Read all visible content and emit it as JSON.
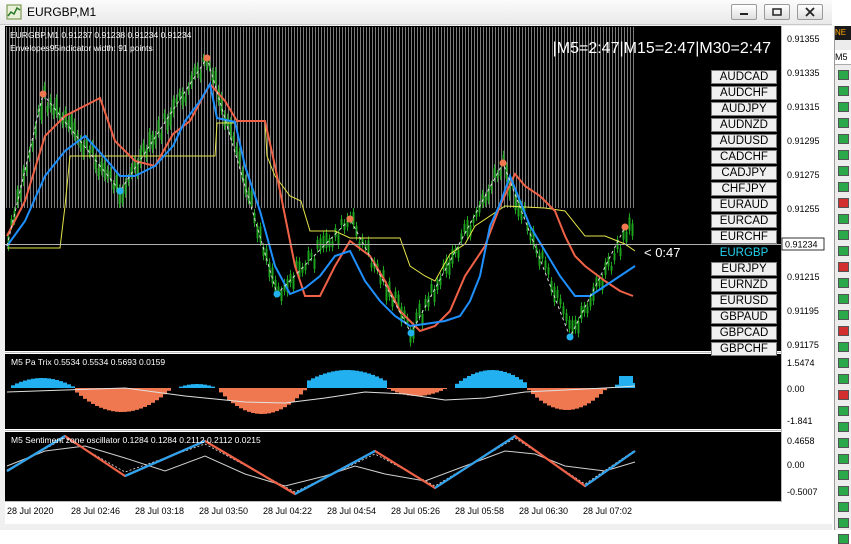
{
  "window": {
    "title": "EURGBP,M1"
  },
  "main": {
    "info": "EURGBP,M1  0.91237 0.91238 0.91234 0.91234",
    "envelopes_info": "Envelopes95indicator width: 91 points",
    "timer": "|M5=2:47|M15=2:47|M30=2:47",
    "countdown": "< 0:47",
    "price_ticks": [
      "0.91355",
      "0.91335",
      "0.91315",
      "0.91295",
      "0.91275",
      "0.91255",
      "0.91215",
      "0.91195",
      "0.91175"
    ],
    "current_price": "0.91234"
  },
  "pairs": [
    "AUDCAD",
    "AUDCHF",
    "AUDJPY",
    "AUDNZD",
    "AUDUSD",
    "CADCHF",
    "CADJPY",
    "CHFJPY",
    "EURAUD",
    "EURCAD",
    "EURCHF",
    "EURGBP",
    "EURJPY",
    "EURNZD",
    "EURUSD",
    "GBPAUD",
    "GBPCAD",
    "GBPCHF"
  ],
  "selected_pair": "EURGBP",
  "trix": {
    "info": "M5 Pa Trix 0.5534 0.5534 0.5693 0.0159",
    "ticks": [
      "1.5474",
      "0.00",
      "-1.841"
    ]
  },
  "sentiment": {
    "info": "M5 Sentiment zone oscillator 0.1284 0.1284 0.2112 0.2112 0.0215",
    "ticks": [
      "0.4658",
      "0.00",
      "-0.5007"
    ]
  },
  "time_axis": [
    "28 Jul 2020",
    "28 Jul 02:46",
    "28 Jul 03:18",
    "28 Jul 03:50",
    "28 Jul 04:22",
    "28 Jul 04:54",
    "28 Jul 05:26",
    "28 Jul 05:58",
    "28 Jul 06:30",
    "28 Jul 07:02"
  ],
  "colors": {
    "bull": "#1ca21c",
    "fast_line": "#1e90ff",
    "slow_line": "#f06248",
    "envelope": "#e6e64a",
    "trix_pos": "#22b0f0",
    "trix_neg": "#f07850",
    "selected_text": "#22d3ee"
  }
}
